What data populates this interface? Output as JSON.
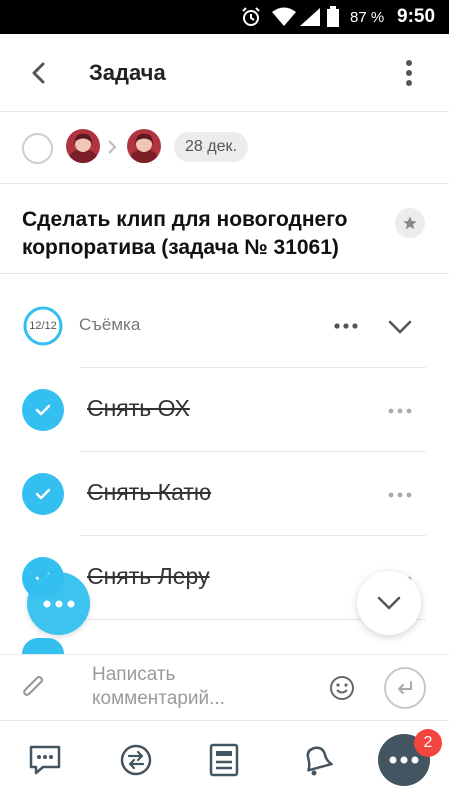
{
  "status_bar": {
    "battery_percent": "87 %",
    "time": "9:50"
  },
  "header": {
    "title": "Задача"
  },
  "meta": {
    "due_date": "28 дек."
  },
  "task": {
    "title": "Сделать клип для новогоднего корпоратива (задача № 31061)"
  },
  "checklist": {
    "name": "Съёмка",
    "progress": "12/12",
    "progress_fraction": 1.0,
    "items": [
      {
        "label": "Снять ОХ",
        "done": true
      },
      {
        "label": "Снять Катю",
        "done": true
      },
      {
        "label": "Снять Леру",
        "done": true
      }
    ]
  },
  "comment": {
    "placeholder": "Написать комментарий..."
  },
  "bottom_nav": {
    "badge_count": "2"
  },
  "colors": {
    "accent": "#33c0f0",
    "badge": "#f2453d",
    "nav_more_bg": "#435561"
  }
}
